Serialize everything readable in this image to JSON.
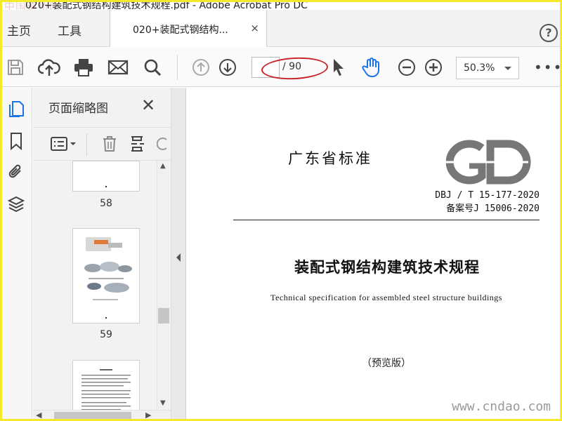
{
  "window": {
    "title": "020+装配式钢结构建筑技术规程.pdf - Adobe Acrobat Pro DC",
    "watermark": "中国道桥网"
  },
  "tabs": {
    "home": "主页",
    "tools": "工具",
    "document": "020+装配式钢结构...",
    "close": "×",
    "help": "?"
  },
  "toolbar": {
    "page_current": "",
    "page_total": "/ 90",
    "zoom": "50.3%",
    "more": "•••"
  },
  "sidebar": {
    "panel_title": "页面缩略图",
    "thumbnails": [
      {
        "label": "58"
      },
      {
        "label": "59"
      },
      {
        "label": ""
      }
    ]
  },
  "document": {
    "standard": "广东省标准",
    "code": "DBJ / T 15-177-2020",
    "record": "备案号J 15006-2020",
    "title_cn": "装配式钢结构建筑技术规程",
    "title_en": "Technical specification for assembled steel structure buildings",
    "preview": "（预览版）",
    "watermark": "www.cndao.com"
  },
  "colors": {
    "accent": "#1a73e8",
    "annotation": "#c8242b",
    "frame": "#f4ea2a"
  }
}
